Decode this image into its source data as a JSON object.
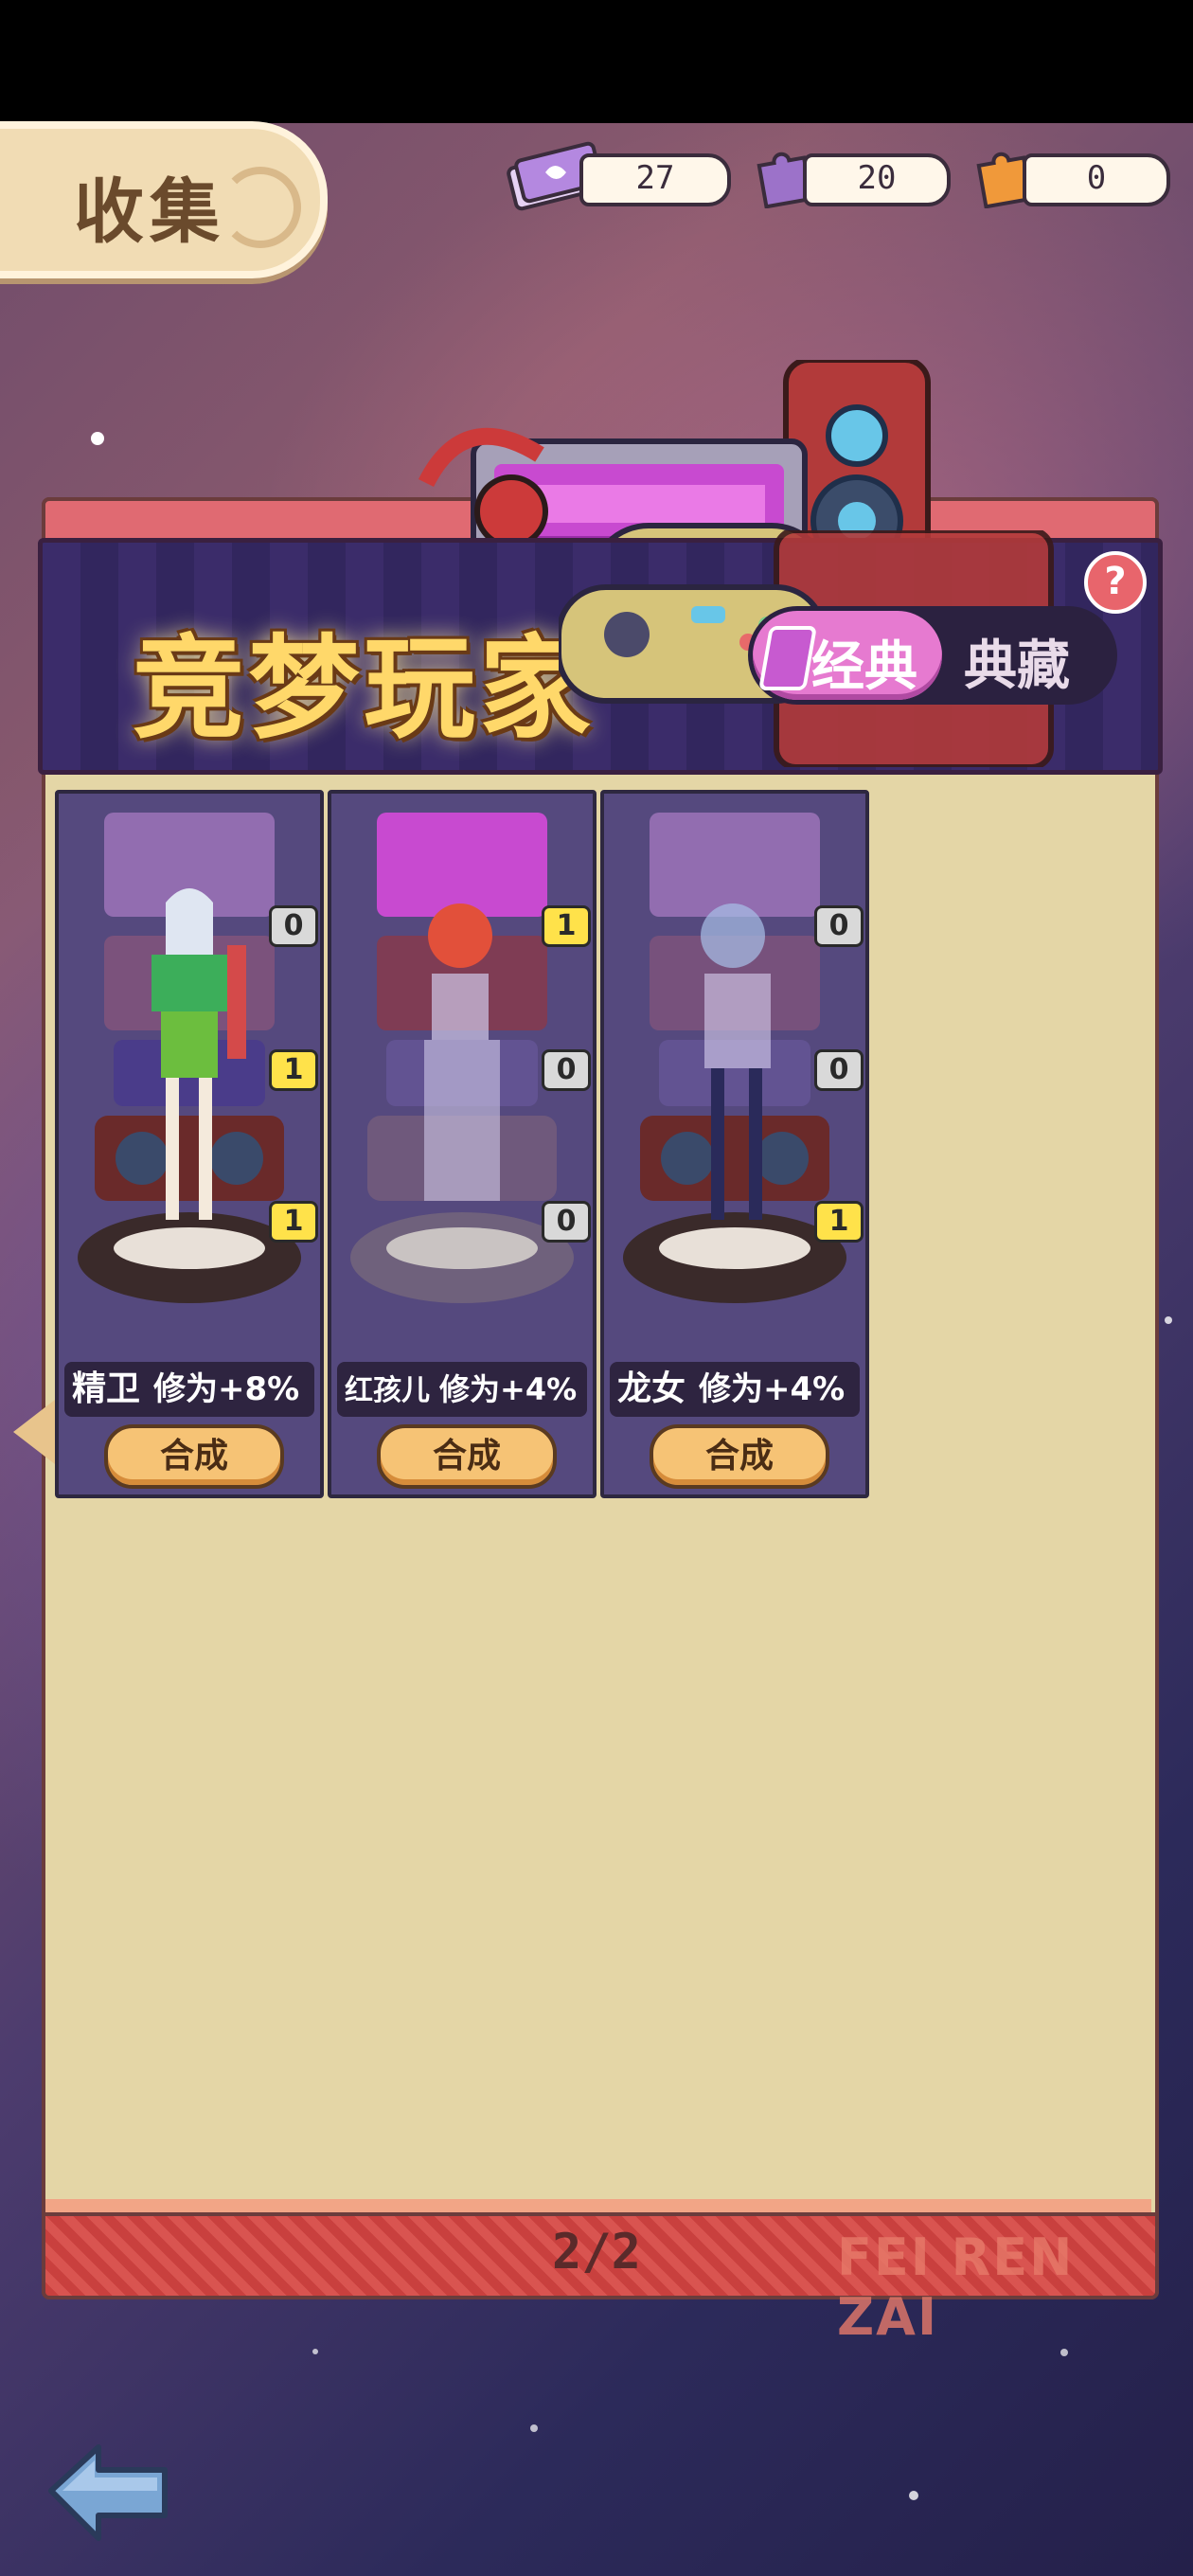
{
  "header": {
    "tab_label": "收集",
    "resources": [
      {
        "name": "ticket-icon",
        "value": "27",
        "color": "#b488e0"
      },
      {
        "name": "purple-puzzle-icon",
        "value": "20",
        "color": "#9c72c9"
      },
      {
        "name": "orange-puzzle-icon",
        "value": "0",
        "color": "#f0993a"
      }
    ]
  },
  "banner": {
    "title": "竞梦玩家",
    "toggle_active": "经典",
    "toggle_inactive": "典藏",
    "help": "?"
  },
  "cards": [
    {
      "name": "精卫",
      "bonus": "修为+8%",
      "button": "合成",
      "counts": [
        "0",
        "1",
        "1"
      ],
      "owned": [
        false,
        true,
        true
      ]
    },
    {
      "name": "红孩儿",
      "bonus": "修为+4%",
      "button": "合成",
      "counts": [
        "1",
        "0",
        "0"
      ],
      "owned": [
        true,
        false,
        false
      ]
    },
    {
      "name": "龙女",
      "bonus": "修为+4%",
      "button": "合成",
      "counts": [
        "0",
        "0",
        "1"
      ],
      "owned": [
        false,
        false,
        true
      ]
    }
  ],
  "footer": {
    "page": "2/2",
    "brand": "FEI REN ZAI"
  },
  "colors": {
    "accent": "#e67ad0",
    "card": "#55497e",
    "panel": "#e4d6a6",
    "button": "#f6c375"
  }
}
